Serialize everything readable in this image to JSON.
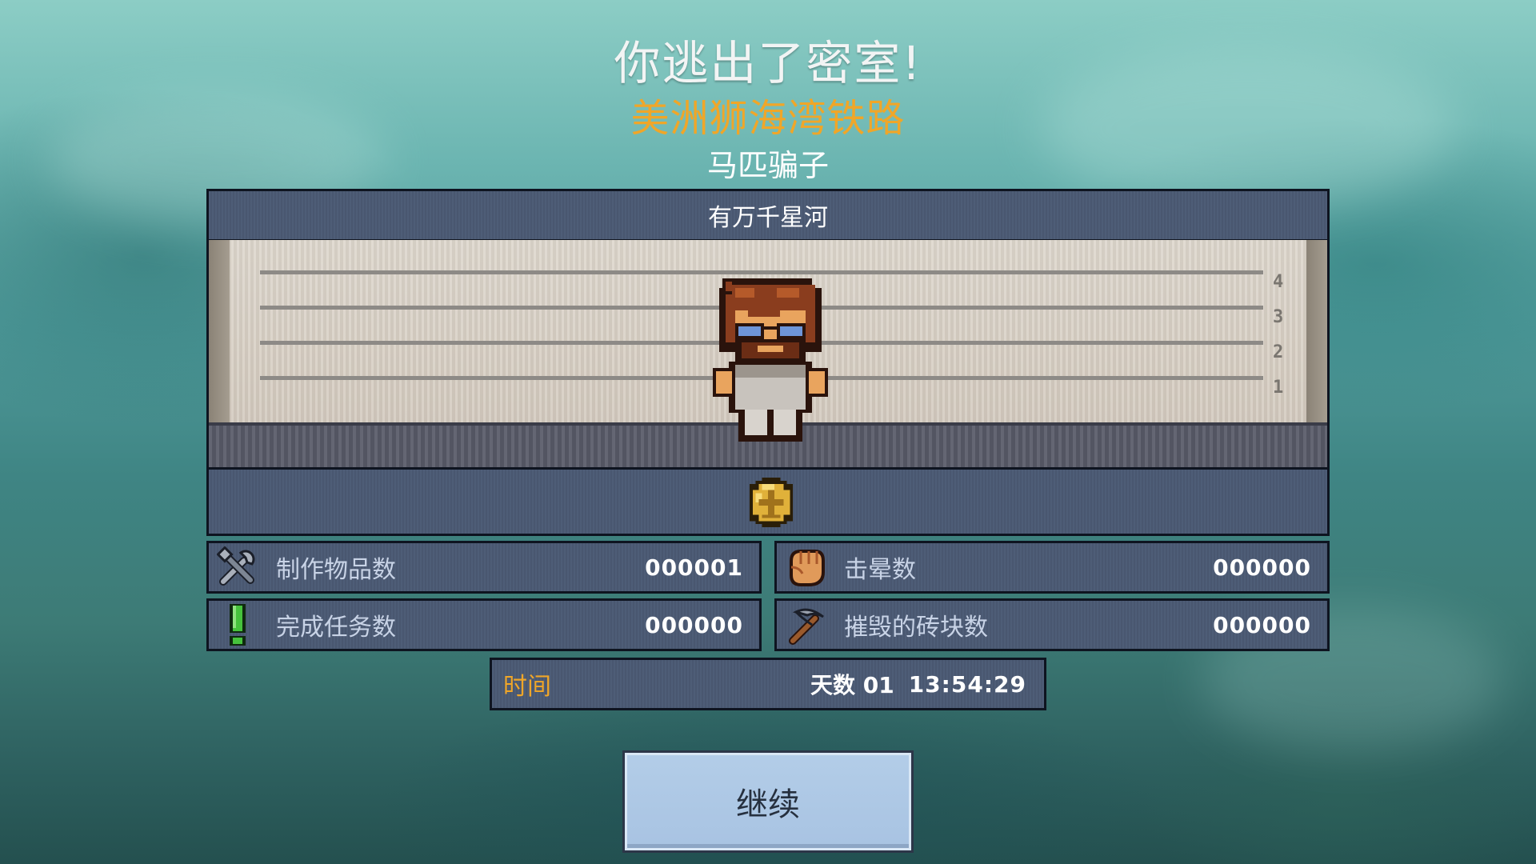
{
  "header": {
    "title": "你逃出了密室!",
    "map_name": "美洲狮海湾铁路",
    "character_title": "马匹骗子"
  },
  "player": {
    "name": "有万千星河"
  },
  "lineup": {
    "height_marks": [
      "4",
      "3",
      "2",
      "1"
    ]
  },
  "stats": [
    {
      "label": "制作物品数",
      "value": "000001",
      "icon": "tools-icon"
    },
    {
      "label": "击晕数",
      "value": "000000",
      "icon": "fist-icon"
    },
    {
      "label": "完成任务数",
      "value": "000000",
      "icon": "exclamation-icon"
    },
    {
      "label": "摧毁的砖块数",
      "value": "000000",
      "icon": "pickaxe-icon"
    }
  ],
  "time": {
    "label": "时间",
    "days": "天数 01",
    "clock": "13:54:29"
  },
  "continue_label": "继续",
  "colors": {
    "accent_orange": "#f0a628",
    "panel": "#4b5a74",
    "panel_border": "#0e1420",
    "button": "#b3cde8"
  }
}
